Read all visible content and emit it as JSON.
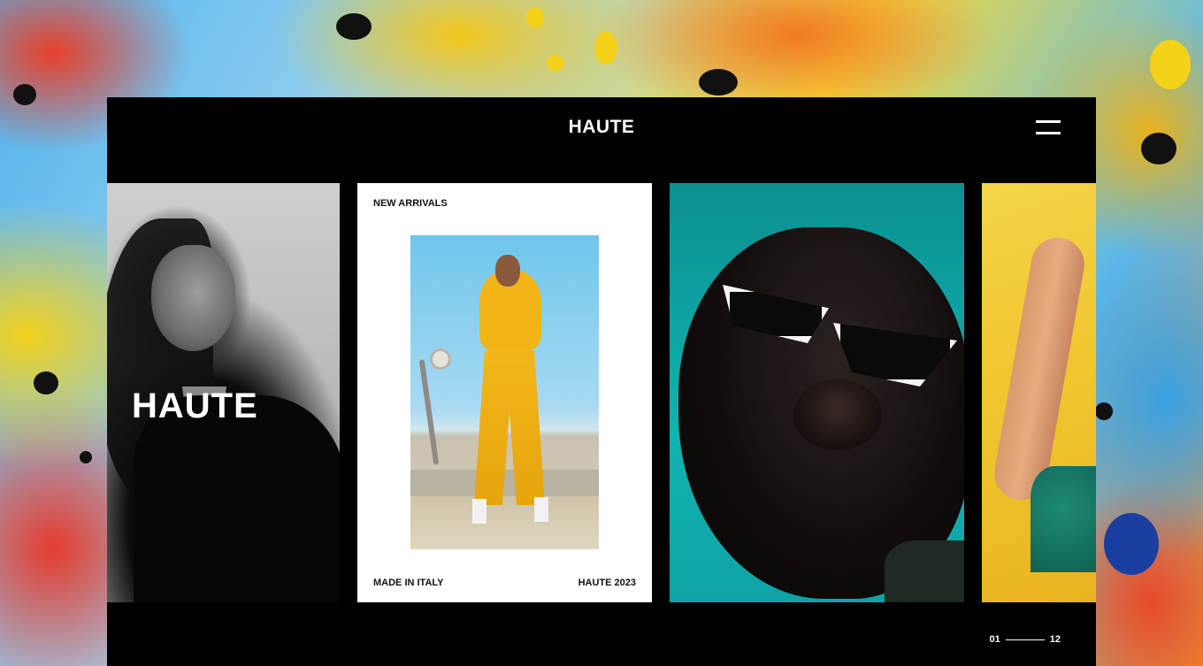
{
  "header": {
    "title": "HAUTE"
  },
  "slides": [
    {
      "type": "hero",
      "title": "HAUTE"
    },
    {
      "type": "card",
      "top_label": "NEW ARRIVALS",
      "bottom_left": "MADE IN ITALY",
      "bottom_right": "HAUTE 2023"
    }
  ],
  "pager": {
    "current": "01",
    "total": "12"
  },
  "icons": {
    "menu": "hamburger-icon"
  },
  "colors": {
    "panel_background": "#000000",
    "text": "#ffffff",
    "card_background": "#ffffff"
  }
}
